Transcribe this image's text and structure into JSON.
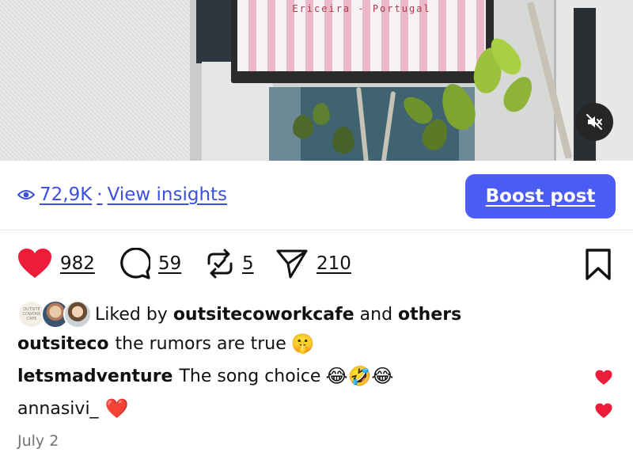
{
  "media": {
    "sign_text": "Ericeira - Portugal",
    "mute_icon": "speaker-muted-icon"
  },
  "insights": {
    "views": "72,9K",
    "separator": "·",
    "link_label": "View insights",
    "boost_label": "Boost post",
    "accent": "#3b4fe0",
    "boost_color": "#4a5cf4"
  },
  "actions": {
    "likes": "982",
    "comments": "59",
    "reposts": "5",
    "shares": "210",
    "heart_color": "#ed1c39"
  },
  "liked_by": {
    "prefix": "Liked by",
    "user": "outsitecoworkcafe",
    "conjunction": "and",
    "others": "others",
    "logo_text": "OUTSITE COWORK CAFE"
  },
  "caption": {
    "username": "outsiteco",
    "text": "the rumors are true",
    "emoji": "🤫"
  },
  "comments": [
    {
      "username": "letsmadventure",
      "text": "The song choice",
      "emoji": "😂🤣😂"
    },
    {
      "username": "annasivi_",
      "text": "",
      "emoji": "❤️"
    }
  ],
  "date": "July 2"
}
